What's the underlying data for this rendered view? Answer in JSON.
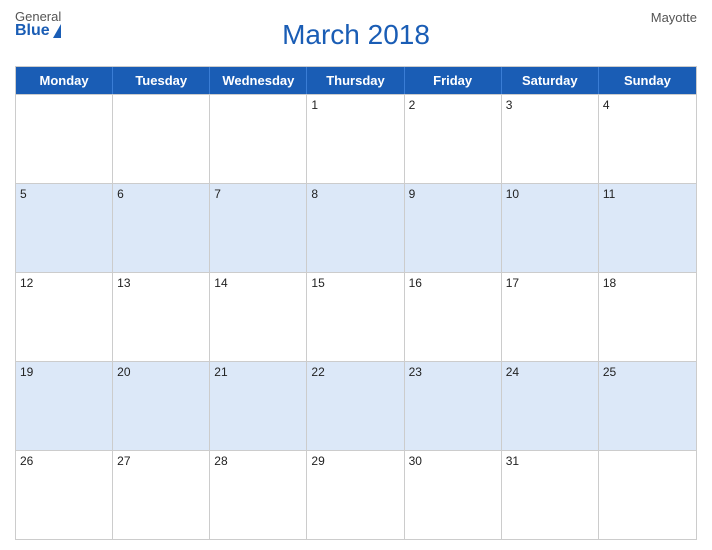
{
  "header": {
    "logo": {
      "general": "General",
      "blue": "Blue"
    },
    "title": "March 2018",
    "region": "Mayotte"
  },
  "weekdays": [
    "Monday",
    "Tuesday",
    "Wednesday",
    "Thursday",
    "Friday",
    "Saturday",
    "Sunday"
  ],
  "weeks": [
    [
      {
        "day": "",
        "shade": false
      },
      {
        "day": "",
        "shade": false
      },
      {
        "day": "",
        "shade": false
      },
      {
        "day": "1",
        "shade": false
      },
      {
        "day": "2",
        "shade": false
      },
      {
        "day": "3",
        "shade": false
      },
      {
        "day": "4",
        "shade": false
      }
    ],
    [
      {
        "day": "5",
        "shade": true
      },
      {
        "day": "6",
        "shade": true
      },
      {
        "day": "7",
        "shade": true
      },
      {
        "day": "8",
        "shade": true
      },
      {
        "day": "9",
        "shade": true
      },
      {
        "day": "10",
        "shade": true
      },
      {
        "day": "11",
        "shade": true
      }
    ],
    [
      {
        "day": "12",
        "shade": false
      },
      {
        "day": "13",
        "shade": false
      },
      {
        "day": "14",
        "shade": false
      },
      {
        "day": "15",
        "shade": false
      },
      {
        "day": "16",
        "shade": false
      },
      {
        "day": "17",
        "shade": false
      },
      {
        "day": "18",
        "shade": false
      }
    ],
    [
      {
        "day": "19",
        "shade": true
      },
      {
        "day": "20",
        "shade": true
      },
      {
        "day": "21",
        "shade": true
      },
      {
        "day": "22",
        "shade": true
      },
      {
        "day": "23",
        "shade": true
      },
      {
        "day": "24",
        "shade": true
      },
      {
        "day": "25",
        "shade": true
      }
    ],
    [
      {
        "day": "26",
        "shade": false
      },
      {
        "day": "27",
        "shade": false
      },
      {
        "day": "28",
        "shade": false
      },
      {
        "day": "29",
        "shade": false
      },
      {
        "day": "30",
        "shade": false
      },
      {
        "day": "31",
        "shade": false
      },
      {
        "day": "",
        "shade": false
      }
    ]
  ]
}
